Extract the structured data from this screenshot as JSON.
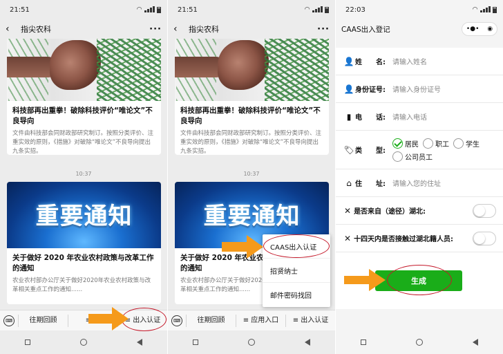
{
  "colors": {
    "accent_green": "#1aad19",
    "arrow_orange": "#f59a1b",
    "highlight_red": "#c4192a"
  },
  "panel1": {
    "time": "21:51",
    "title": "指尖农科",
    "card1": {
      "title": "科技部再出重拳！破除科技评价“唯论文”不良导向",
      "desc": "文件由科技部会同财政部研究制订。按照分类评价、注重实效的原则，《措施》对破除“唯论文”不良导向提出九条实招。"
    },
    "timestamp": "10:37",
    "card2": {
      "image_text": "重要通知",
      "title": "关于做好 2020 年农业农村政策与改革工作的通知",
      "desc": "农业农村部办公厅关于做好2020年农业农村政策与改革相关重点工作的通知......"
    },
    "tabs": [
      "往期回顾",
      "≡ 应",
      "≡ 出入认证"
    ]
  },
  "panel2": {
    "time": "21:51",
    "title": "指尖农科",
    "card1": {
      "title": "科技部再出重拳！破除科技评价“唯论文”不良导向",
      "desc": "文件由科技部会同财政部研究制订。按照分类评价、注重实效的原则，《措施》对破除“唯论文”不良导向提出九条实招。"
    },
    "timestamp": "10:37",
    "card2": {
      "image_text": "重要通知",
      "title": "关于做好 2020 年农业农村政策与改革工作的通知",
      "desc": "农业农村部办公厅关于做好2020年农业农村政策与改革相关重点工作的通知......"
    },
    "tabs": [
      "往期回顾",
      "≡ 应用入口",
      "≡ 出入认证"
    ],
    "popup": [
      "CAAS出入认证",
      "招贤纳士",
      "邮件密码找回"
    ]
  },
  "panel3": {
    "time": "22:03",
    "title": "CAAS出入登记",
    "fields": {
      "name": {
        "label": "姓　　名:",
        "placeholder": "请输入姓名"
      },
      "id": {
        "label": "身份证号:",
        "placeholder": "请输入身份证号"
      },
      "phone": {
        "label": "电　　话:",
        "placeholder": "请输入电话"
      },
      "type": {
        "label": "类　　型:",
        "options": [
          "居民",
          "职工",
          "学生",
          "公司员工"
        ],
        "selected": "居民"
      },
      "address": {
        "label": "住　　址:",
        "placeholder": "请输入您的住址"
      }
    },
    "toggles": {
      "hubei": "是否来自（途径）湖北:",
      "contact": "十四天内是否接触过湖北籍人员:"
    },
    "submit": "生成"
  }
}
